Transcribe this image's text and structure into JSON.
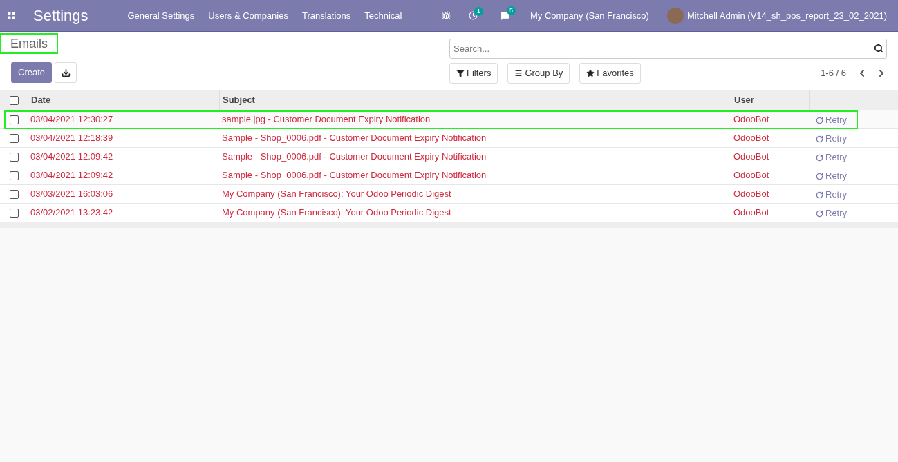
{
  "navbar": {
    "app_title": "Settings",
    "menu": [
      "General Settings",
      "Users & Companies",
      "Translations",
      "Technical"
    ],
    "activity_count": "1",
    "message_count": "5",
    "company": "My Company (San Francisco)",
    "user": "Mitchell Admin (V14_sh_pos_report_23_02_2021)"
  },
  "control_panel": {
    "title": "Emails",
    "title_highlighted": true,
    "create_label": "Create",
    "search": {
      "placeholder": "Search..."
    },
    "filters": [
      "Filters",
      "Group By",
      "Favorites"
    ],
    "pager": "1-6 / 6"
  },
  "table": {
    "columns": [
      "Date",
      "Subject",
      "User"
    ],
    "select_all_checked": false,
    "rows": [
      {
        "date": "03/04/2021 12:30:27",
        "subject": "sample.jpg - Customer Document Expiry Notification",
        "user": "OdooBot",
        "action": "Retry",
        "checked": false,
        "highlighted": true
      },
      {
        "date": "03/04/2021 12:18:39",
        "subject": "Sample - Shop_0006.pdf - Customer Document Expiry Notification",
        "user": "OdooBot",
        "action": "Retry",
        "checked": false,
        "highlighted": false
      },
      {
        "date": "03/04/2021 12:09:42",
        "subject": "Sample - Shop_0006.pdf - Customer Document Expiry Notification",
        "user": "OdooBot",
        "action": "Retry",
        "checked": false,
        "highlighted": false
      },
      {
        "date": "03/04/2021 12:09:42",
        "subject": "Sample - Shop_0006.pdf - Customer Document Expiry Notification",
        "user": "OdooBot",
        "action": "Retry",
        "checked": false,
        "highlighted": false
      },
      {
        "date": "03/03/2021 16:03:06",
        "subject": "My Company (San Francisco): Your Odoo Periodic Digest",
        "user": "OdooBot",
        "action": "Retry",
        "checked": false,
        "highlighted": false
      },
      {
        "date": "03/02/2021 13:23:42",
        "subject": "My Company (San Francisco): Your Odoo Periodic Digest",
        "user": "OdooBot",
        "action": "Retry",
        "checked": false,
        "highlighted": false
      }
    ]
  }
}
